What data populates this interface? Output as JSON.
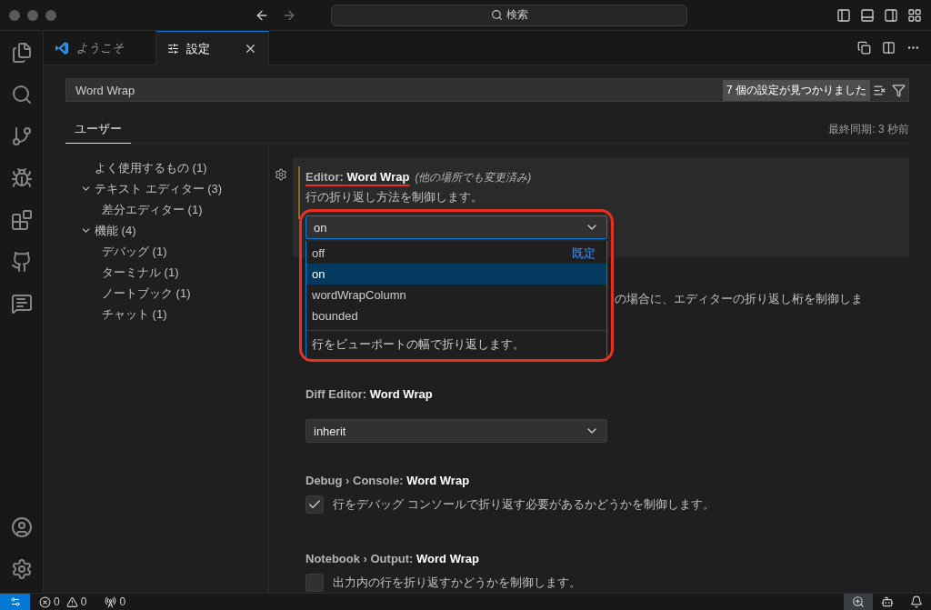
{
  "titlebar": {
    "search": "検索"
  },
  "editor_tabs": [
    {
      "label": "ようこそ",
      "kind": "welcome",
      "selected": false
    },
    {
      "label": "設定",
      "kind": "settings",
      "selected": true
    }
  ],
  "settings_search": {
    "value": "Word Wrap",
    "result_count": "7 個の設定が見つかりました"
  },
  "scope_tabs": [
    {
      "label": "ユーザー",
      "selected": true
    }
  ],
  "sync_status": "最終同期: 3 秒前",
  "toc": [
    {
      "label": "よく使用するもの (1)"
    },
    {
      "label": "テキスト エディター (3)",
      "expanded": true,
      "children": [
        {
          "label": "差分エディター (1)"
        }
      ]
    },
    {
      "label": "機能 (4)",
      "expanded": true,
      "children": [
        {
          "label": "デバッグ (1)"
        },
        {
          "label": "ターミナル (1)"
        },
        {
          "label": "ノートブック (1)"
        },
        {
          "label": "チャット (1)"
        }
      ]
    }
  ],
  "settings": [
    {
      "kind": "select",
      "category": "Editor:",
      "name": "Word Wrap",
      "note": "(他の場所でも変更済み)",
      "description": "行の折り返し方法を制御します。",
      "value": "on",
      "focused": true,
      "annotated": true,
      "open": true,
      "options": [
        {
          "label": "off",
          "badge": "既定",
          "selected": false
        },
        {
          "label": "on",
          "selected": true
        },
        {
          "label": "wordWrapColumn",
          "selected": false
        },
        {
          "label": "bounded",
          "selected": false
        }
      ],
      "option_description": "行をビューポートの幅で折り返します。"
    },
    {
      "kind": "partial",
      "description": "の場合に、エディターの折り返し桁を制御しま"
    },
    {
      "kind": "select",
      "category": "Diff Editor:",
      "name": "Word Wrap",
      "value": "inherit",
      "focused": false,
      "annotated": false,
      "open": false
    },
    {
      "kind": "checkbox",
      "category": "Debug › Console:",
      "name": "Word Wrap",
      "description": "行をデバッグ コンソールで折り返す必要があるかどうかを制御します。",
      "checked": true
    },
    {
      "kind": "checkbox",
      "category": "Notebook › Output:",
      "name": "Word Wrap",
      "description": "出力内の行を折り返すかどうかを制御します。",
      "checked": false
    }
  ],
  "status_bar": {
    "errors": "0",
    "warnings": "0",
    "ports": "0"
  }
}
